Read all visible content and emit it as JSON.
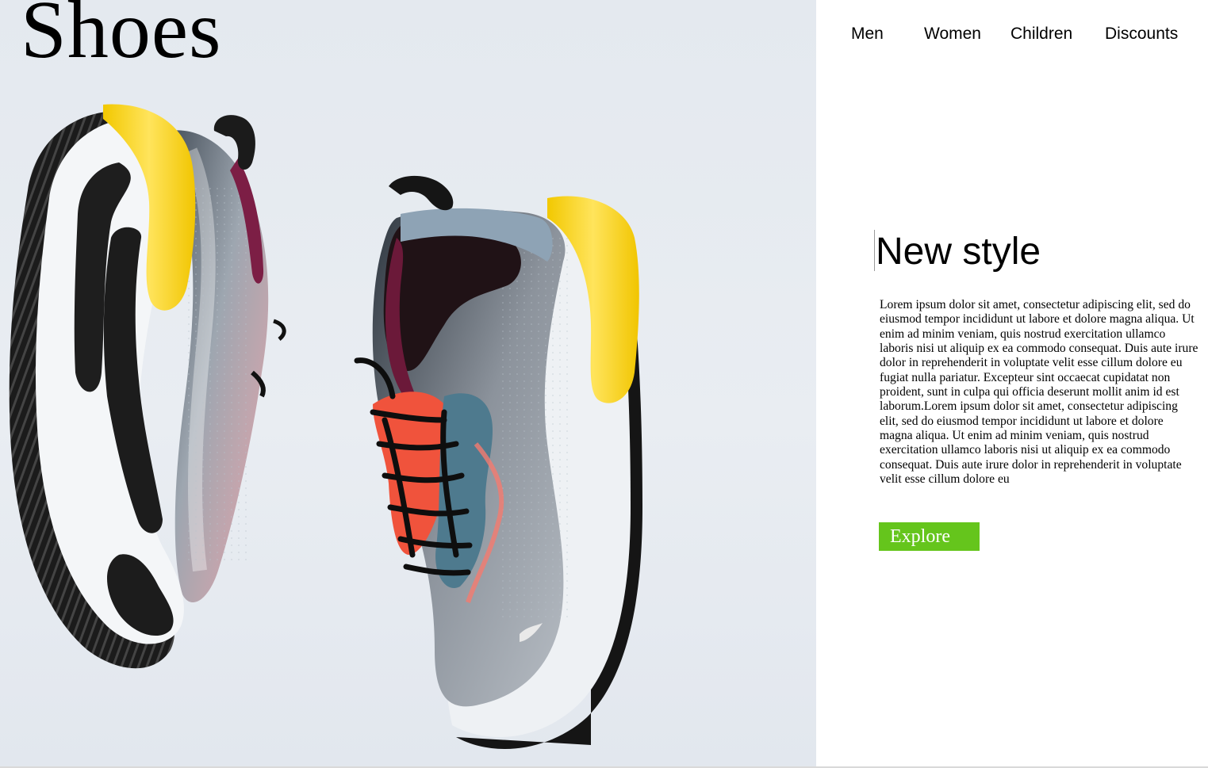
{
  "brand": {
    "title": "Shoes"
  },
  "nav": {
    "items": [
      {
        "label": "Men"
      },
      {
        "label": "Women"
      },
      {
        "label": "Children"
      },
      {
        "label": "Discounts"
      }
    ]
  },
  "hero": {
    "image": "sneakers-pair-photo"
  },
  "main": {
    "headline": "New style",
    "body": "Lorem ipsum dolor sit amet, consectetur adipiscing elit, sed do eiusmod tempor incididunt ut labore et dolore magna aliqua. Ut enim ad minim veniam, quis nostrud exercitation ullamco laboris nisi ut aliquip ex ea commodo consequat. Duis aute irure dolor in reprehenderit in voluptate velit esse cillum dolore eu fugiat nulla pariatur. Excepteur sint occaecat cupidatat non proident, sunt in culpa qui officia deserunt mollit anim id est laborum.Lorem ipsum dolor sit amet, consectetur adipiscing elit, sed do eiusmod tempor incididunt ut labore et dolore magna aliqua. Ut enim ad minim veniam, quis nostrud exercitation ullamco laboris nisi ut aliquip ex ea commodo consequat. Duis aute irure dolor in reprehenderit in voluptate velit esse cillum dolore eu",
    "cta_label": "Explore"
  },
  "colors": {
    "cta_background": "#65c51c",
    "hero_background": "#e6ebf0",
    "accent_yellow": "#f5d20a"
  }
}
